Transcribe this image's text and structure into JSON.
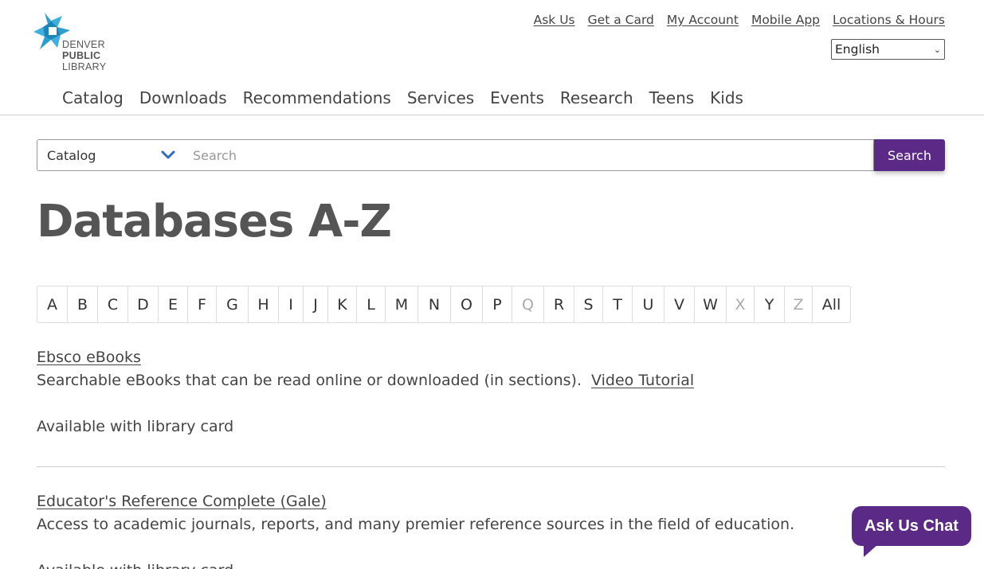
{
  "logo": {
    "line1": "DENVER",
    "line2": "PUBLIC",
    "line3": "LIBRARY",
    "icon": "dpl-star-logo",
    "color": "#2a9fd0"
  },
  "utility_nav": [
    "Ask Us",
    "Get a Card",
    "My Account",
    "Mobile App",
    "Locations & Hours"
  ],
  "language": {
    "selected": "English"
  },
  "main_nav": [
    "Catalog",
    "Downloads",
    "Recommendations",
    "Services",
    "Events",
    "Research",
    "Teens",
    "Kids"
  ],
  "search": {
    "scope": "Catalog",
    "placeholder": "Search",
    "button": "Search"
  },
  "page_title": "Databases A-Z",
  "az": {
    "letters": [
      {
        "label": "A",
        "enabled": true
      },
      {
        "label": "B",
        "enabled": true
      },
      {
        "label": "C",
        "enabled": true
      },
      {
        "label": "D",
        "enabled": true
      },
      {
        "label": "E",
        "enabled": true
      },
      {
        "label": "F",
        "enabled": true
      },
      {
        "label": "G",
        "enabled": true
      },
      {
        "label": "H",
        "enabled": true
      },
      {
        "label": "I",
        "enabled": true
      },
      {
        "label": "J",
        "enabled": true
      },
      {
        "label": "K",
        "enabled": true
      },
      {
        "label": "L",
        "enabled": true
      },
      {
        "label": "M",
        "enabled": true
      },
      {
        "label": "N",
        "enabled": true
      },
      {
        "label": "O",
        "enabled": true
      },
      {
        "label": "P",
        "enabled": true
      },
      {
        "label": "Q",
        "enabled": false
      },
      {
        "label": "R",
        "enabled": true
      },
      {
        "label": "S",
        "enabled": true
      },
      {
        "label": "T",
        "enabled": true
      },
      {
        "label": "U",
        "enabled": true
      },
      {
        "label": "V",
        "enabled": true
      },
      {
        "label": "W",
        "enabled": true
      },
      {
        "label": "X",
        "enabled": false
      },
      {
        "label": "Y",
        "enabled": true
      },
      {
        "label": "Z",
        "enabled": false
      },
      {
        "label": "All",
        "enabled": true
      }
    ]
  },
  "databases": [
    {
      "title": "Ebsco eBooks",
      "description": "Searchable eBooks that can be read online or downloaded (in sections).",
      "tutorial_link": "Video Tutorial",
      "availability": "Available with library card"
    },
    {
      "title": "Educator's Reference Complete (Gale)",
      "description": "Access to academic journals, reports, and many premier reference sources in the field of education.",
      "availability": "Available with library card"
    }
  ],
  "chat": {
    "label": "Ask Us Chat"
  },
  "colors": {
    "accent": "#5b2a86",
    "link": "#444444",
    "logo_blue": "#2a9fd0"
  }
}
